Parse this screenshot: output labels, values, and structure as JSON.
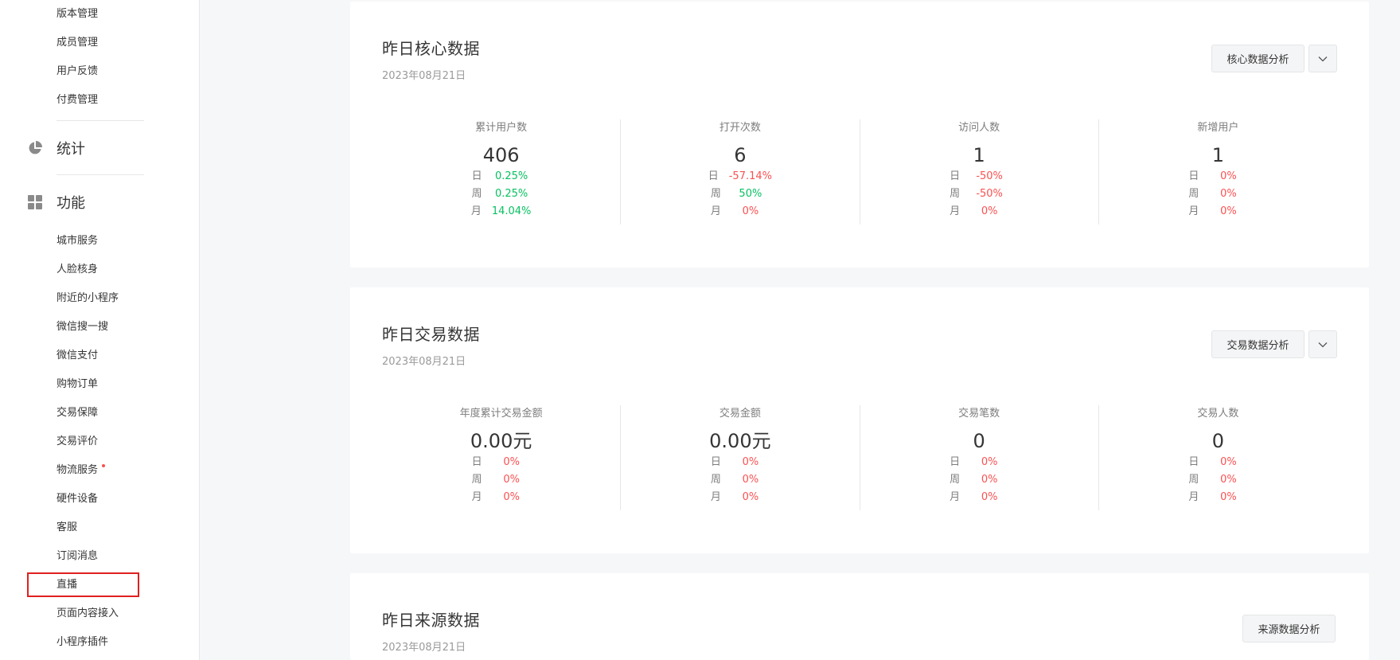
{
  "sidebar": {
    "top_items": [
      {
        "label": "版本管理"
      },
      {
        "label": "成员管理"
      },
      {
        "label": "用户反馈"
      },
      {
        "label": "付费管理"
      }
    ],
    "section_stats": {
      "label": "统计",
      "icon": "pie-chart-icon"
    },
    "section_features": {
      "label": "功能",
      "icon": "grid-icon"
    },
    "feature_items": [
      {
        "label": "城市服务"
      },
      {
        "label": "人脸核身"
      },
      {
        "label": "附近的小程序"
      },
      {
        "label": "微信搜一搜"
      },
      {
        "label": "微信支付"
      },
      {
        "label": "购物订单"
      },
      {
        "label": "交易保障"
      },
      {
        "label": "交易评价"
      },
      {
        "label": "物流服务",
        "badge": true
      },
      {
        "label": "硬件设备"
      },
      {
        "label": "客服"
      },
      {
        "label": "订阅消息"
      },
      {
        "label": "直播",
        "highlighted": true
      },
      {
        "label": "页面内容接入"
      },
      {
        "label": "小程序插件"
      }
    ]
  },
  "cards": [
    {
      "title": "昨日核心数据",
      "date": "2023年08月21日",
      "button": "核心数据分析",
      "has_dropdown": true,
      "metrics": [
        {
          "label": "累计用户数",
          "value": "406",
          "rates": [
            {
              "k": "日",
              "v": "0.25%",
              "trend": "pos"
            },
            {
              "k": "周",
              "v": "0.25%",
              "trend": "pos"
            },
            {
              "k": "月",
              "v": "14.04%",
              "trend": "pos"
            }
          ]
        },
        {
          "label": "打开次数",
          "value": "6",
          "rates": [
            {
              "k": "日",
              "v": "-57.14%",
              "trend": "neg"
            },
            {
              "k": "周",
              "v": "50%",
              "trend": "pos"
            },
            {
              "k": "月",
              "v": "0%",
              "trend": "neg"
            }
          ]
        },
        {
          "label": "访问人数",
          "value": "1",
          "rates": [
            {
              "k": "日",
              "v": "-50%",
              "trend": "neg"
            },
            {
              "k": "周",
              "v": "-50%",
              "trend": "neg"
            },
            {
              "k": "月",
              "v": "0%",
              "trend": "neg"
            }
          ]
        },
        {
          "label": "新增用户",
          "value": "1",
          "rates": [
            {
              "k": "日",
              "v": "0%",
              "trend": "neg"
            },
            {
              "k": "周",
              "v": "0%",
              "trend": "neg"
            },
            {
              "k": "月",
              "v": "0%",
              "trend": "neg"
            }
          ]
        }
      ]
    },
    {
      "title": "昨日交易数据",
      "date": "2023年08月21日",
      "button": "交易数据分析",
      "has_dropdown": true,
      "metrics": [
        {
          "label": "年度累计交易金额",
          "value": "0.00元",
          "rates": [
            {
              "k": "日",
              "v": "0%",
              "trend": "neg"
            },
            {
              "k": "周",
              "v": "0%",
              "trend": "neg"
            },
            {
              "k": "月",
              "v": "0%",
              "trend": "neg"
            }
          ]
        },
        {
          "label": "交易金额",
          "value": "0.00元",
          "rates": [
            {
              "k": "日",
              "v": "0%",
              "trend": "neg"
            },
            {
              "k": "周",
              "v": "0%",
              "trend": "neg"
            },
            {
              "k": "月",
              "v": "0%",
              "trend": "neg"
            }
          ]
        },
        {
          "label": "交易笔数",
          "value": "0",
          "rates": [
            {
              "k": "日",
              "v": "0%",
              "trend": "neg"
            },
            {
              "k": "周",
              "v": "0%",
              "trend": "neg"
            },
            {
              "k": "月",
              "v": "0%",
              "trend": "neg"
            }
          ]
        },
        {
          "label": "交易人数",
          "value": "0",
          "rates": [
            {
              "k": "日",
              "v": "0%",
              "trend": "neg"
            },
            {
              "k": "周",
              "v": "0%",
              "trend": "neg"
            },
            {
              "k": "月",
              "v": "0%",
              "trend": "neg"
            }
          ]
        }
      ]
    },
    {
      "title": "昨日来源数据",
      "date": "2023年08月21日",
      "button": "来源数据分析",
      "has_dropdown": false,
      "metrics": []
    }
  ],
  "colors": {
    "positive": "#07c160",
    "negative": "#fa5151",
    "highlight_border": "#e02020"
  }
}
